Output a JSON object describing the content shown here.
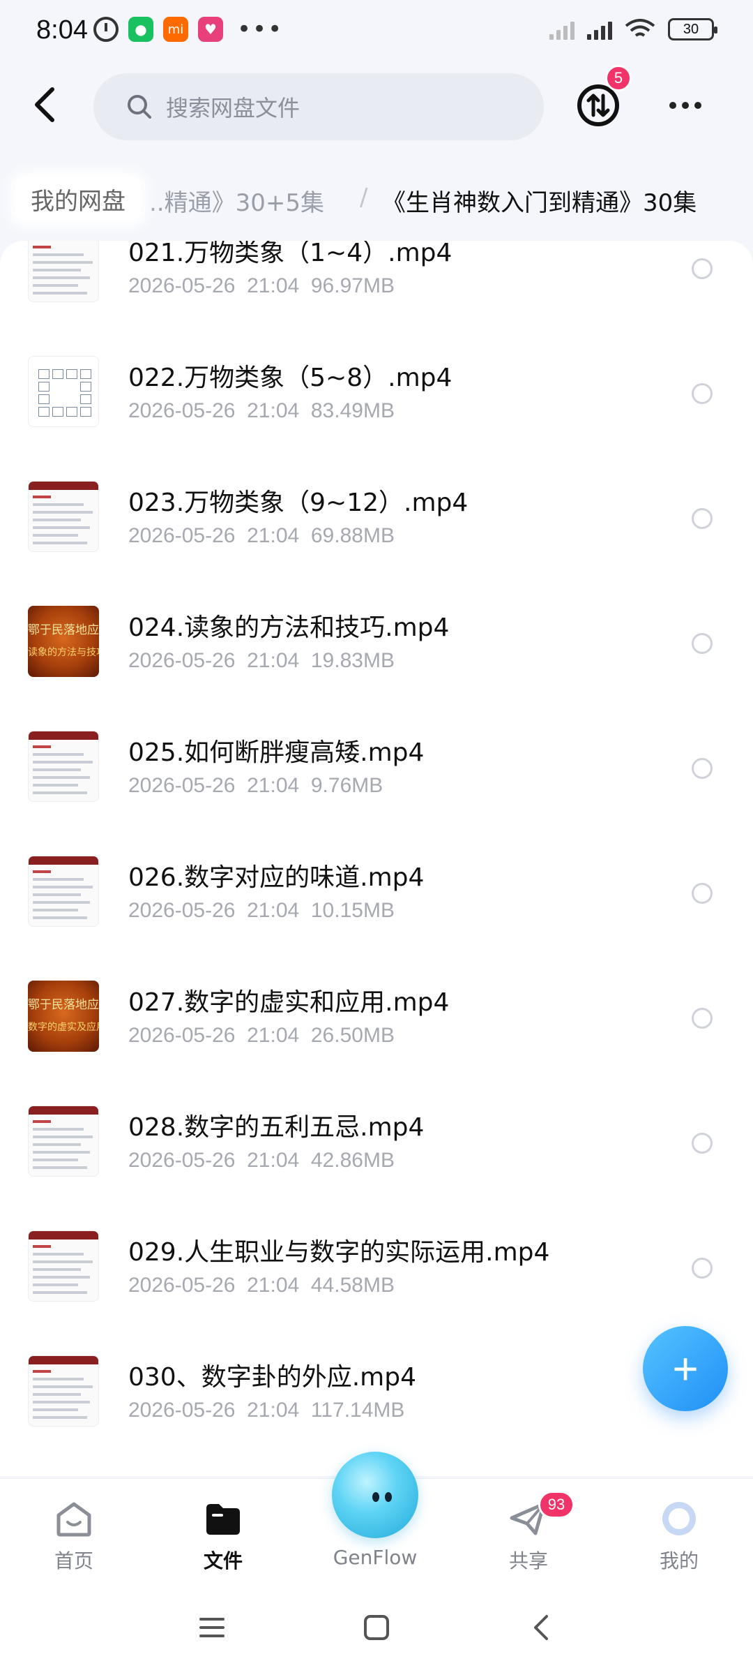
{
  "status_bar": {
    "time": "8:04",
    "battery": "30",
    "more": "•••"
  },
  "header": {
    "search_placeholder": "搜索网盘文件",
    "transfer_badge": "5"
  },
  "breadcrumb": {
    "home": "我的网盘",
    "middle": "..精通》30+5集",
    "separator": "/",
    "current": "《生肖神数入门到精通》30集"
  },
  "files": [
    {
      "name": "021.万物类象（1~4）.mp4",
      "date": "2026-05-26  21:04",
      "size": "96.97MB",
      "thumb": "doc"
    },
    {
      "name": "022.万物类象（5~8）.mp4",
      "date": "2026-05-26  21:04",
      "size": "83.49MB",
      "thumb": "grid"
    },
    {
      "name": "023.万物类象（9~12）.mp4",
      "date": "2026-05-26  21:04",
      "size": "69.88MB",
      "thumb": "doc"
    },
    {
      "name": "024.读象的方法和技巧.mp4",
      "date": "2026-05-26  21:04",
      "size": "19.83MB",
      "thumb": "video"
    },
    {
      "name": "025.如何断胖瘦高矮.mp4",
      "date": "2026-05-26  21:04",
      "size": "9.76MB",
      "thumb": "doc"
    },
    {
      "name": "026.数字对应的味道.mp4",
      "date": "2026-05-26  21:04",
      "size": "10.15MB",
      "thumb": "doc"
    },
    {
      "name": "027.数字的虚实和应用.mp4",
      "date": "2026-05-26  21:04",
      "size": "26.50MB",
      "thumb": "video"
    },
    {
      "name": "028.数字的五利五忌.mp4",
      "date": "2026-05-26  21:04",
      "size": "42.86MB",
      "thumb": "doc"
    },
    {
      "name": "029.人生职业与数字的实际运用.mp4",
      "date": "2026-05-26  21:04",
      "size": "44.58MB",
      "thumb": "doc"
    },
    {
      "name": "030、数字卦的外应.mp4",
      "date": "2026-05-26  21:04",
      "size": "117.14MB",
      "thumb": "doc"
    }
  ],
  "thumb_text": {
    "video_line1": "鄂于民落地应",
    "video_line2_024": "读象的方法与技巧",
    "video_line2_027": "数字的虚实及应用"
  },
  "fab": {
    "label": "+"
  },
  "bottom_nav": {
    "home": "首页",
    "files": "文件",
    "genflow": "GenFlow",
    "share": "共享",
    "share_badge": "93",
    "me": "我的"
  },
  "colors": {
    "accent": "#1f8ff7",
    "badge": "#f0346a",
    "background": "#f4f6fb"
  }
}
